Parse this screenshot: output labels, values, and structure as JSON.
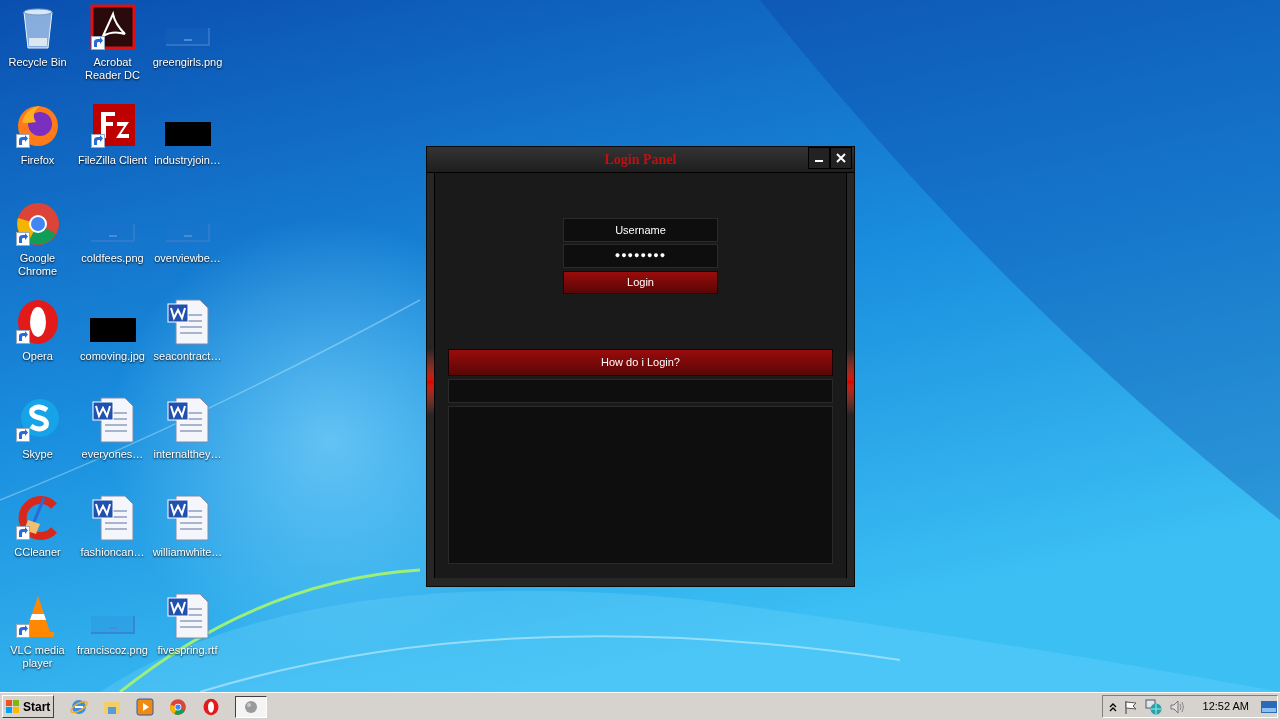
{
  "desktop": {
    "icons": [
      {
        "label": "Recycle Bin",
        "kind": "recycle-bin",
        "shortcut": false
      },
      {
        "label": "Firefox",
        "kind": "firefox",
        "shortcut": true
      },
      {
        "label": "Google Chrome",
        "kind": "chrome",
        "shortcut": true
      },
      {
        "label": "Opera",
        "kind": "opera",
        "shortcut": true
      },
      {
        "label": "Skype",
        "kind": "skype",
        "shortcut": true
      },
      {
        "label": "CCleaner",
        "kind": "ccleaner",
        "shortcut": true
      },
      {
        "label": "VLC media player",
        "kind": "vlc",
        "shortcut": true
      },
      {
        "label": "Acrobat Reader DC",
        "kind": "acrobat",
        "shortcut": true
      },
      {
        "label": "FileZilla Client",
        "kind": "filezilla",
        "shortcut": true
      },
      {
        "label": "coldfees.png",
        "kind": "blank-image",
        "shortcut": false
      },
      {
        "label": "comoving.jpg",
        "kind": "black-image",
        "shortcut": false
      },
      {
        "label": "everyones…",
        "kind": "word",
        "shortcut": false
      },
      {
        "label": "fashioncan…",
        "kind": "word",
        "shortcut": false
      },
      {
        "label": "franciscoz.png",
        "kind": "blank-image",
        "shortcut": false
      },
      {
        "label": "greengirls.png",
        "kind": "blank-image",
        "shortcut": false
      },
      {
        "label": "industryjoin…",
        "kind": "black-image",
        "shortcut": false
      },
      {
        "label": "overviewbe…",
        "kind": "blank-image",
        "shortcut": false
      },
      {
        "label": "seacontract…",
        "kind": "word",
        "shortcut": false
      },
      {
        "label": "internalthey…",
        "kind": "word",
        "shortcut": false
      },
      {
        "label": "williamwhite…",
        "kind": "word",
        "shortcut": false
      },
      {
        "label": "fivespring.rtf",
        "kind": "word",
        "shortcut": false
      }
    ]
  },
  "window": {
    "title": "Login Panel",
    "username": "Username",
    "password": "●●●●●●●●",
    "login_button": "Login",
    "help_button": "How do i Login?"
  },
  "taskbar": {
    "start": "Start",
    "items": [
      {
        "kind": "ie",
        "selected": false
      },
      {
        "kind": "explorer",
        "selected": false
      },
      {
        "kind": "media",
        "selected": false
      },
      {
        "kind": "chrome",
        "selected": false
      },
      {
        "kind": "opera",
        "selected": false
      },
      {
        "kind": "app",
        "selected": true
      }
    ],
    "tray": [
      {
        "kind": "chevron"
      },
      {
        "kind": "flag"
      },
      {
        "kind": "network"
      },
      {
        "kind": "speaker"
      }
    ],
    "clock": "12:52 AM"
  }
}
